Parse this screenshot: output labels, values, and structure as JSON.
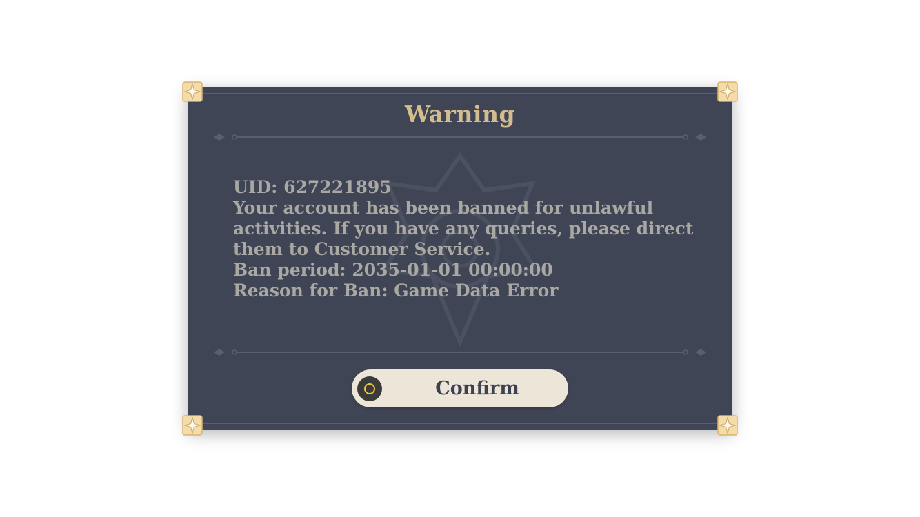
{
  "dialog": {
    "title": "Warning",
    "message_lines": [
      "UID: 627221895",
      "Your account has been banned for unlawful",
      "activities. If you have any queries, please direct",
      "them to Customer Service.",
      "Ban period: 2035-01-01 00:00:00",
      "Reason for Ban: Game Data Error"
    ],
    "confirm_label": "Confirm",
    "confirm_icon": "controller-o-button-icon"
  },
  "colors": {
    "panel_background": "#404556",
    "title": "#d3bc8e",
    "message_text": "#a9a8a3",
    "button_background": "#ece5d8",
    "button_text": "#3d4152",
    "icon_ring": "#f0c92e"
  }
}
